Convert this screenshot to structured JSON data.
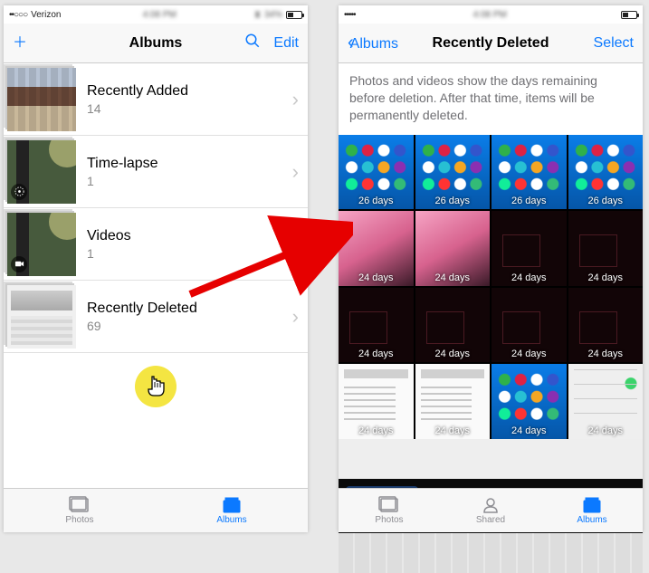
{
  "left": {
    "status": {
      "carrier": "Verizon",
      "signal_dots": "••○○○",
      "wifi": true,
      "battery_pct": 34
    },
    "nav": {
      "title": "Albums",
      "add_glyph": "＋",
      "edit_label": "Edit"
    },
    "albums": [
      {
        "name": "Recently Added",
        "count": "14",
        "thumb": "recent"
      },
      {
        "name": "Time-lapse",
        "count": "1",
        "thumb": "timelapse",
        "badge": "timelapse"
      },
      {
        "name": "Videos",
        "count": "1",
        "thumb": "videos",
        "badge": "video"
      },
      {
        "name": "Recently Deleted",
        "count": "69",
        "thumb": "deleted"
      }
    ],
    "tabs": {
      "photos": "Photos",
      "albums": "Albums",
      "active": "albums"
    }
  },
  "right": {
    "status": {
      "signal_dots": "•••••",
      "wifi": true
    },
    "nav": {
      "back_label": "Albums",
      "title": "Recently Deleted",
      "select_label": "Select"
    },
    "info": "Photos and videos show the days remaining before deletion. After that time, items will be permanently deleted.",
    "grid": [
      {
        "t": "home",
        "d": "26 days"
      },
      {
        "t": "home",
        "d": "26 days"
      },
      {
        "t": "home",
        "d": "26 days"
      },
      {
        "t": "home",
        "d": "26 days"
      },
      {
        "t": "kb",
        "d": "24 days"
      },
      {
        "t": "kb",
        "d": "24 days"
      },
      {
        "t": "dark",
        "d": "24 days"
      },
      {
        "t": "dark",
        "d": "24 days"
      },
      {
        "t": "dark",
        "d": "24 days"
      },
      {
        "t": "dark",
        "d": "24 days"
      },
      {
        "t": "dark",
        "d": "24 days"
      },
      {
        "t": "dark",
        "d": "24 days"
      },
      {
        "t": "doc",
        "d": "24 days"
      },
      {
        "t": "doc",
        "d": "24 days"
      },
      {
        "t": "home",
        "d": "24 days"
      },
      {
        "t": "settings",
        "d": "24 days"
      }
    ],
    "tabs": {
      "photos": "Photos",
      "shared": "Shared",
      "albums": "Albums",
      "active": "albums"
    }
  }
}
